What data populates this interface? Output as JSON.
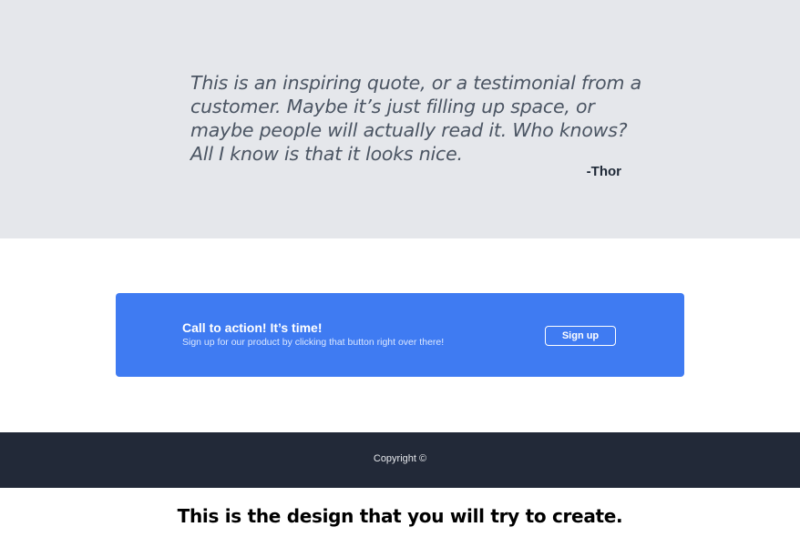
{
  "quote": {
    "text": "This is an inspiring quote, or a testimonial from a customer.  Maybe it’s just filling up space, or maybe people will actually read it. Who knows?  All I know is that it looks nice.",
    "author": "-Thor"
  },
  "cta": {
    "heading": "Call to action! It’s time!",
    "subtext": "Sign up for our product by clicking that button right over there!",
    "button_label": "Sign up"
  },
  "footer": {
    "copyright": "Copyright  ©"
  },
  "caption": "This is the design that you will try to create.",
  "colors": {
    "quote_background": "#e5e7eb",
    "cta_background": "#3f7bf2",
    "footer_background": "#222938"
  }
}
